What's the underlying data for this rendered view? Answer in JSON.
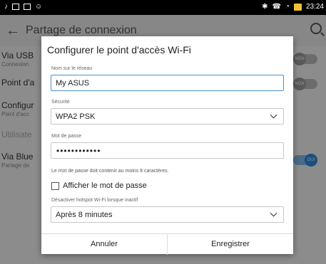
{
  "status_bar": {
    "time": "23:24"
  },
  "app_bar": {
    "title": "Partage de connexion"
  },
  "background": {
    "usb_title": "Via USB",
    "usb_sub": "Connexion",
    "hotspot_title": "Point d'a",
    "config_title": "Configur",
    "config_sub": "Point d'acc",
    "users_title": "Utilisate",
    "bt_title": "Via Blue",
    "bt_sub": "Partage de",
    "toggle_non": "NON",
    "toggle_oui": "OUI"
  },
  "dialog": {
    "title": "Configurer le point d'accès Wi-Fi",
    "network_name_label": "Nom sur le réseau",
    "network_name_value": "My ASUS",
    "security_label": "Sécurité",
    "security_value": "WPA2 PSK",
    "password_label": "Mot de passe",
    "password_value": "••••••••••••",
    "password_hint": "Le mot de passe doit contenir au moins 8 caractères.",
    "show_password_label": "Afficher le mot de passe",
    "inactive_label": "Désactiver hotspot Wi-Fi lorsque inactif",
    "inactive_value": "Après 8 minutes",
    "cancel_label": "Annuler",
    "save_label": "Enregistrer"
  }
}
